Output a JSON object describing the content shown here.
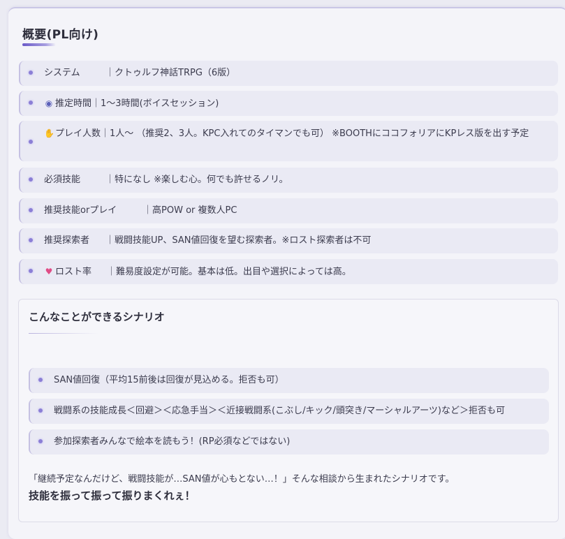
{
  "section": {
    "title": "概要(PL向け)"
  },
  "overview_items": [
    {
      "label": "システム",
      "value": "クトゥルフ神話TRPG（6版）",
      "icon": ""
    },
    {
      "label": "推定時間",
      "value": "1〜3時間(ボイスセッション)",
      "icon": "stopwatch-icon"
    },
    {
      "label": "プレイ人数",
      "value": "1人〜 （推奨2、3人。KPC入れてのタイマンでも可） ※BOOTHにココフォリアにKPレス版を出す予定",
      "icon": "raised-hand-icon"
    },
    {
      "label": "必須技能",
      "value": "特になし ※楽しむ心。何でも許せるノリ。",
      "icon": ""
    },
    {
      "label": "推奨技能orプレイ",
      "value": "高POW or 複数人PC",
      "icon": ""
    },
    {
      "label": "推奨探索者",
      "value": "戦闘技能UP、SAN値回復を望む探索者。※ロスト探索者は不可",
      "icon": ""
    },
    {
      "label": "ロスト率",
      "value": "難易度設定が可能。基本は低。出目や選択によっては高。",
      "icon": "heart-icon"
    }
  ],
  "scenario_box": {
    "title": "こんなことができるシナリオ",
    "items": [
      "SAN値回復（平均15前後は回復が見込める。拒否も可）",
      "戦闘系の技能成長＜回避＞＜応急手当＞＜近接戦闘系(こぶし/キック/頭突き/マーシャルアーツ)など＞拒否も可",
      "参加探索者みんなで絵本を読もう！(RP必須などではない)"
    ],
    "quote": "「継続予定なんだけど、戦闘技能が…SAN値が心もとない…！」そんな相談から生まれたシナリオです。",
    "emphasis": "技能を振って振って振りまくれぇ！"
  },
  "colors": {
    "accent": "#7b6fd0",
    "item_background": "#eaeaf4",
    "heart": "#e04c86"
  }
}
